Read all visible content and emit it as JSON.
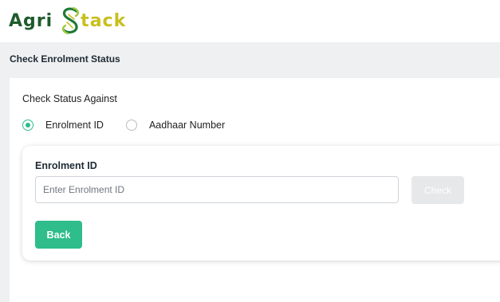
{
  "header": {
    "logo_left_text": "Agri",
    "logo_right_text": "tack",
    "logo_icon": "stylized-s-leaf-icon"
  },
  "page_title": "Check Enrolment Status",
  "form": {
    "section_label": "Check Status Against",
    "radio_options": [
      {
        "label": "Enrolment ID",
        "checked": true
      },
      {
        "label": "Aadhaar Number",
        "checked": false
      }
    ],
    "field_label": "Enrolment ID",
    "field_placeholder": "Enter Enrolment ID",
    "field_value": "",
    "check_button": "Check",
    "back_button": "Back"
  },
  "colors": {
    "brand_dark_green": "#1f5b2c",
    "brand_yellow_green": "#c8bf1f",
    "accent_green": "#2ebd8b",
    "disabled_button": "#e6e8ea",
    "page_background": "#eef0f2"
  }
}
